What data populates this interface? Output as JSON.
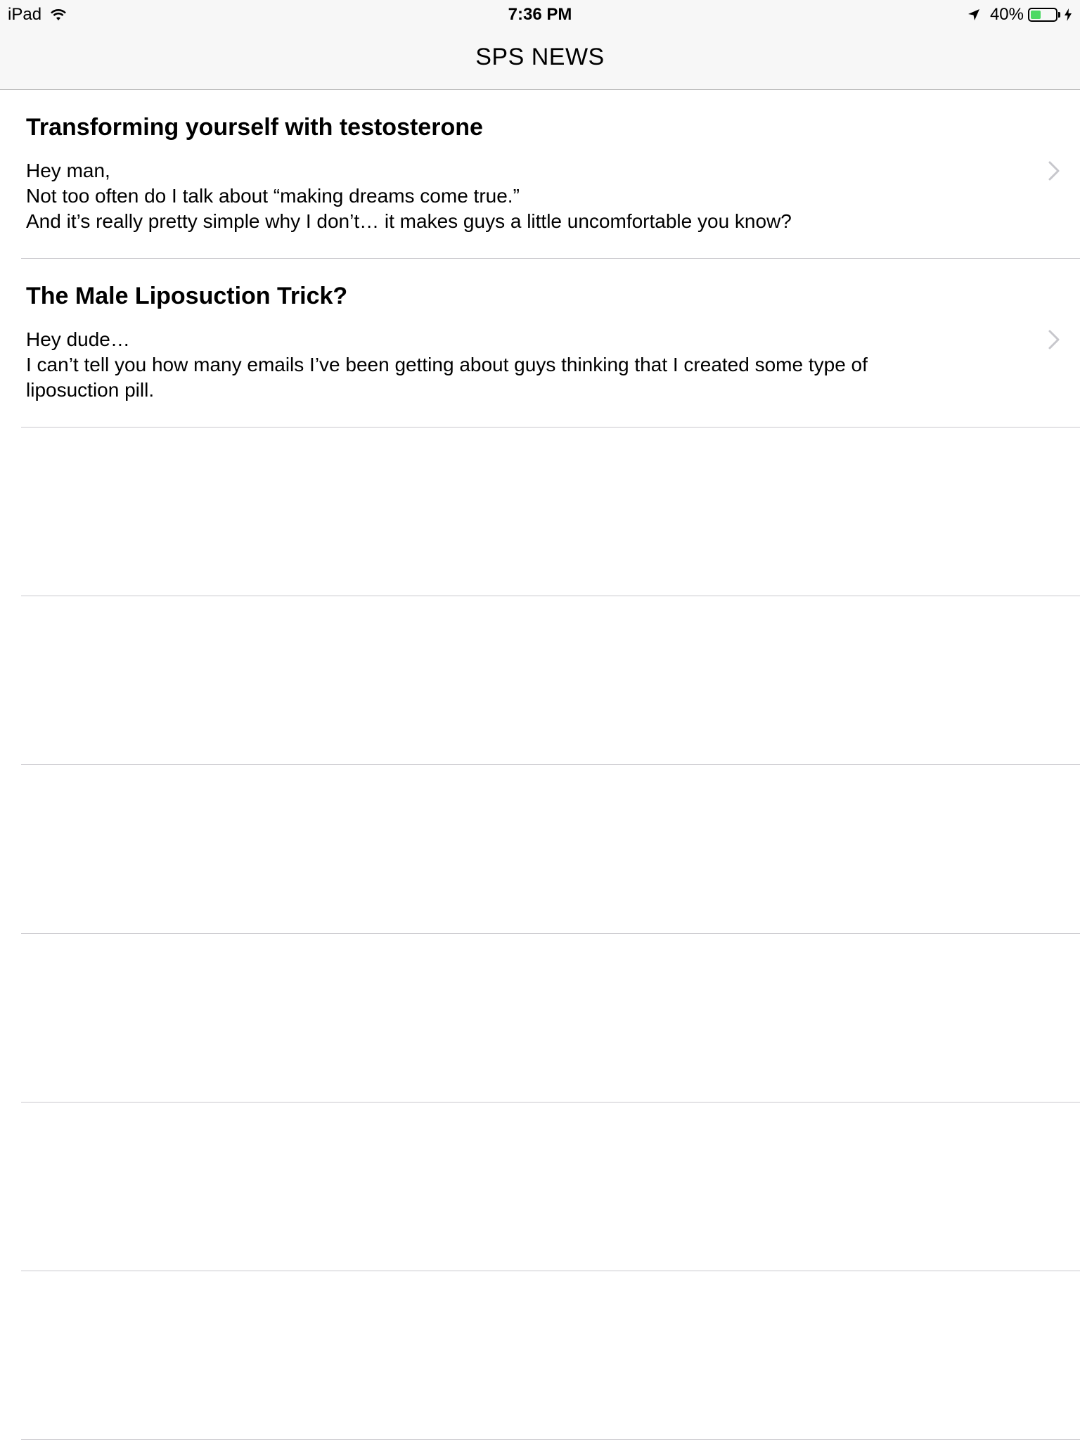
{
  "status_bar": {
    "device": "iPad",
    "time": "7:36 PM",
    "battery_percent": "40%",
    "battery_level": 0.4,
    "icons": [
      "wifi-icon",
      "location-arrow-icon",
      "battery-icon",
      "charging-bolt-icon"
    ]
  },
  "nav": {
    "title": "SPS NEWS"
  },
  "articles": [
    {
      "title": "Transforming yourself with testosterone",
      "lines": [
        "Hey man,",
        "Not too often do I talk about “making dreams come true.”",
        "And it’s really pretty simple why I don’t… it makes guys a little uncomfortable you know?"
      ]
    },
    {
      "title": "The Male Liposuction Trick?",
      "lines": [
        "Hey dude…",
        "I can’t tell you how many emails I’ve been getting about guys thinking that I created some type of",
        "liposuction pill."
      ]
    }
  ],
  "colors": {
    "bar_background": "#f7f7f7",
    "separator": "#c8c7cc",
    "battery_fill": "#4cd964",
    "chevron": "#c7c7cc"
  }
}
